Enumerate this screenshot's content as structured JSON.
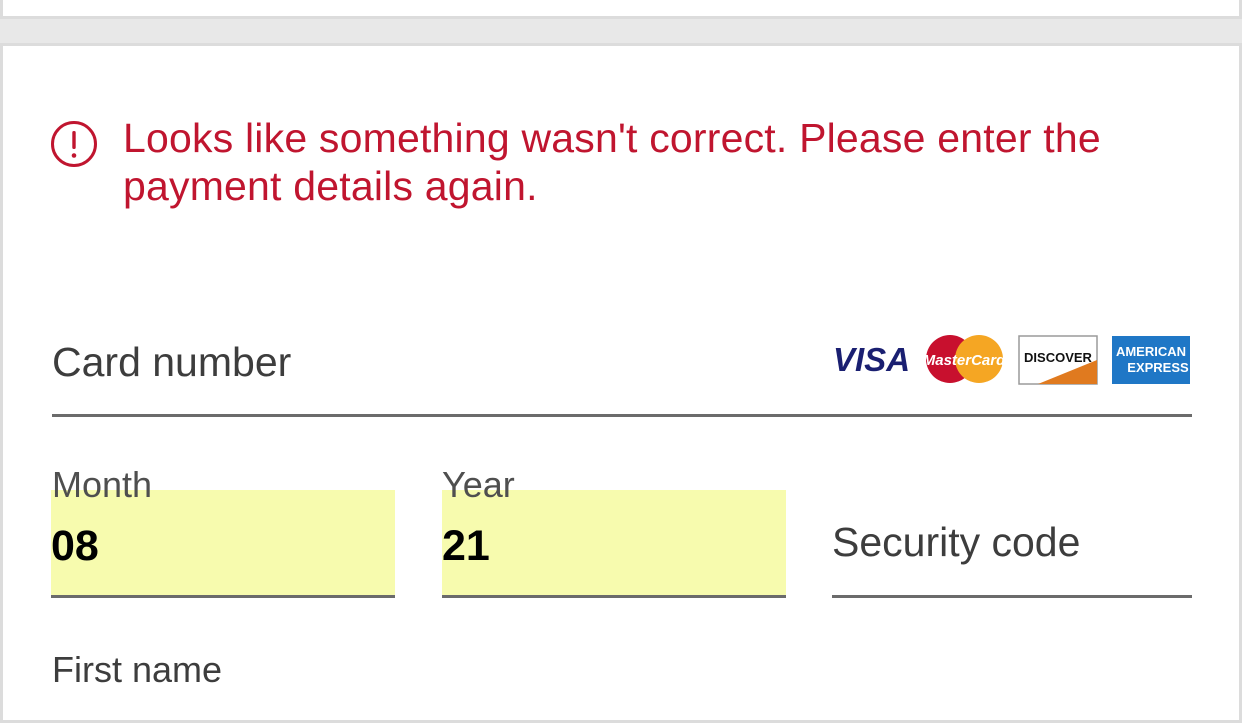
{
  "error": {
    "icon": "alert-circle-icon",
    "message": "Looks like something wasn't correct. Please enter the payment details again.",
    "color": "#c0152f"
  },
  "card": {
    "label": "Card number",
    "logos": {
      "visa": "VISA",
      "mastercard": "MasterCard",
      "discover": "DISCOVER",
      "amex_line1": "AMERICAN",
      "amex_line2": "EXPRESS"
    }
  },
  "expiry": {
    "month_label": "Month",
    "month_value": "08",
    "year_label": "Year",
    "year_value": "21",
    "highlight_color": "#f7fbae"
  },
  "security": {
    "label": "Security code"
  },
  "name": {
    "first_label": "First name"
  }
}
